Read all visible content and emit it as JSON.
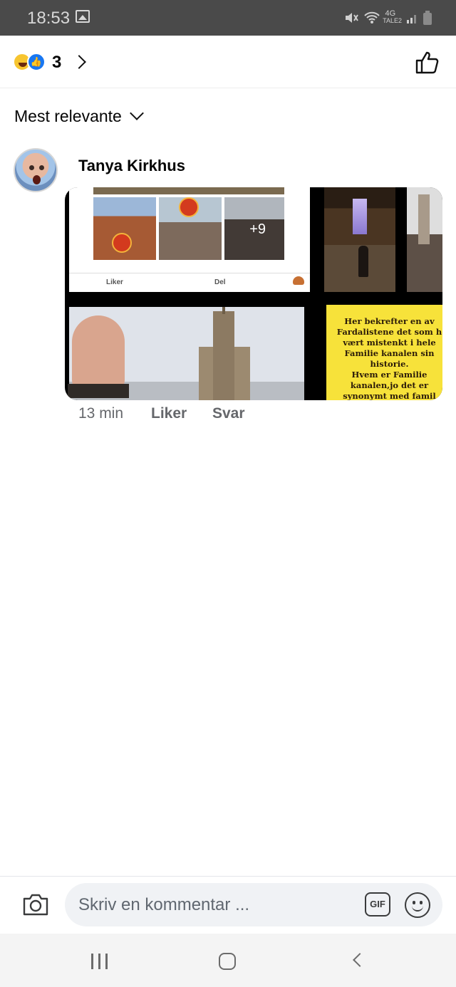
{
  "status_bar": {
    "time": "18:53",
    "network": "4G",
    "carrier": "TALE2",
    "icons": [
      "gallery-icon",
      "mute-icon",
      "wifi-icon",
      "signal-icon",
      "battery-icon"
    ]
  },
  "reactions": {
    "icons": [
      "haha-reaction-icon",
      "like-reaction-icon"
    ],
    "count": "3",
    "like_icon": "thumbs-up-icon"
  },
  "sort": {
    "label": "Mest relevante"
  },
  "comment": {
    "author": "Tanya Kirkhus",
    "media": {
      "inner_post_like": "Liker",
      "inner_post_share": "Del",
      "more_count": "+9",
      "yellow_text": "Her bekrefter en av\nFardalistene det som h\nvært mistenkt i hele\nFamilie kanalen sin\nhistorie.\nHvem er Familie\nkanalen,jo det er\nsynonymt med famil"
    },
    "time": "13 min",
    "like_label": "Liker",
    "reply_label": "Svar"
  },
  "composer": {
    "placeholder": "Skriv en kommentar ...",
    "gif_label": "GIF",
    "icons": [
      "camera-icon",
      "gif-icon",
      "emoji-icon"
    ]
  },
  "nav": {
    "icons": [
      "recents-icon",
      "home-icon",
      "back-icon"
    ]
  },
  "colors": {
    "accent": "#1877f2",
    "status_bar": "#4a4a4a",
    "meta_text": "#65676b",
    "input_bg": "#f0f2f5",
    "yellow_panel": "#f7e23a"
  }
}
